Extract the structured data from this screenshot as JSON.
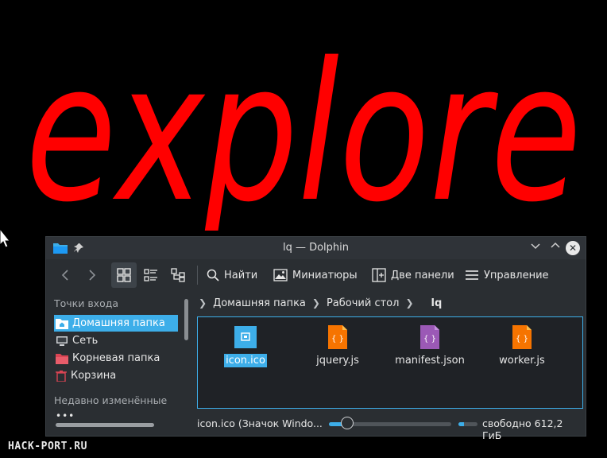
{
  "headline": {
    "text": "explore",
    "color": "#ff0000"
  },
  "watermark": "HACK-PORT.RU",
  "window": {
    "title": "lq — Dolphin",
    "accent": "#3daee9",
    "toolbar": {
      "find_label": "Найти",
      "preview_label": "Миниатюры",
      "split_label": "Две панели",
      "menu_label": "Управление"
    },
    "sidebar": {
      "places_heading": "Точки входа",
      "items": [
        {
          "label": "Домашняя папка",
          "icon": "folder-home-icon"
        },
        {
          "label": "Сеть",
          "icon": "network-icon"
        },
        {
          "label": "Корневая папка",
          "icon": "root-folder-icon"
        },
        {
          "label": "Корзина",
          "icon": "trash-icon"
        }
      ],
      "recent_heading": "Недавно изменённые"
    },
    "breadcrumb": [
      "Домашняя папка",
      "Рабочий стол",
      "lq"
    ],
    "files": [
      {
        "name": "icon.ico",
        "type": "image",
        "selected": true
      },
      {
        "name": "jquery.js",
        "type": "javascript"
      },
      {
        "name": "manifest.json",
        "type": "json"
      },
      {
        "name": "worker.js",
        "type": "javascript"
      }
    ],
    "status": {
      "text": "icon.ico (Значок Windo...",
      "zoom_fraction": 0.15,
      "free_space": "свободно 612,2 ГиБ",
      "used_fraction": 0.3
    }
  }
}
